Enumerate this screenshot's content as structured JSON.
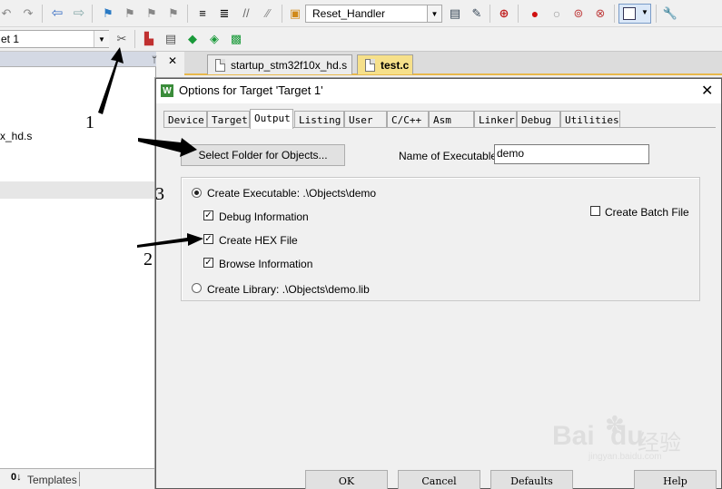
{
  "toolbar": {
    "function_combo_value": "Reset_Handler",
    "target_combo_value": "et 1"
  },
  "project_pane": {
    "file_label": "x_hd.s",
    "bottom_tab_label": "Templates",
    "bottom_tab_prefix": "0↓"
  },
  "editor_tabs": [
    {
      "label": "startup_stm32f10x_hd.s"
    },
    {
      "label": "test.c"
    }
  ],
  "dialog": {
    "title": "Options for Target 'Target 1'",
    "close_glyph": "✕",
    "icon_letter": "W",
    "tabs": [
      {
        "label": "Device"
      },
      {
        "label": "Target"
      },
      {
        "label": "Output"
      },
      {
        "label": "Listing"
      },
      {
        "label": "User"
      },
      {
        "label": "C/C++"
      },
      {
        "label": "Asm"
      },
      {
        "label": "Linker"
      },
      {
        "label": "Debug"
      },
      {
        "label": "Utilities"
      }
    ],
    "active_tab": "Output",
    "select_folder_label": "Select Folder for Objects...",
    "name_of_executable_label": "Name of Executable:",
    "name_of_executable_value": "demo",
    "create_executable_label": "Create Executable:  .\\Objects\\demo",
    "debug_information_label": "Debug Information",
    "create_hex_label": "Create HEX File",
    "browse_information_label": "Browse Information",
    "create_library_label": "Create Library:  .\\Objects\\demo.lib",
    "create_batch_label": "Create Batch File",
    "create_executable_selected": true,
    "debug_information_checked": true,
    "create_hex_checked": true,
    "browse_information_checked": true,
    "create_batch_checked": false,
    "buttons": {
      "ok": "OK",
      "cancel": "Cancel",
      "defaults": "Defaults",
      "help": "Help"
    }
  },
  "annotations": {
    "one": "1",
    "two": "2",
    "three": "3"
  },
  "watermark": {
    "brand": "Bai",
    "brand_suffix": "du",
    "cn": "经验",
    "url": "jingyan.baidu.com"
  },
  "icons": [
    "undo-icon",
    "redo-icon",
    "back-icon",
    "forward-icon",
    "bookmark-icon",
    "indent-icon",
    "find-icon",
    "debug-icon",
    "breakpoint-icon",
    "wrench-icon",
    "options-icon",
    "build-icon",
    "pin-icon",
    "close-icon"
  ],
  "colors": {
    "active_tab": "#f6e08a",
    "breakpoint": "#d01010",
    "arrow": "#000000"
  }
}
